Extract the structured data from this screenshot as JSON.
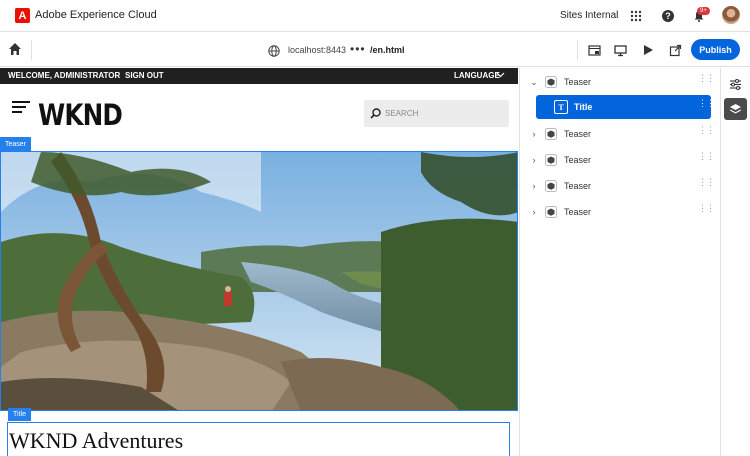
{
  "header": {
    "product_name": "Adobe Experience Cloud",
    "logo_letter": "A",
    "org_name": "Sites Internal",
    "notifications_badge": "9+"
  },
  "toolbar": {
    "host": "localhost:8443",
    "more_label": "•••",
    "path": "/en.html",
    "publish_label": "Publish"
  },
  "site": {
    "welcome_text": "WELCOME, ADMINISTRATOR",
    "sign_out": "SIGN OUT",
    "language": "LANGUAGE",
    "logo": "WKND",
    "search_placeholder": "SEARCH",
    "teaser_tag": "Teaser",
    "title_tag": "Title",
    "page_title": "WKND Adventures"
  },
  "tree": {
    "items": [
      {
        "label": "Teaser",
        "expanded": true
      },
      {
        "label": "Title",
        "selected": true
      },
      {
        "label": "Teaser",
        "expanded": false
      },
      {
        "label": "Teaser",
        "expanded": false
      },
      {
        "label": "Teaser",
        "expanded": false
      },
      {
        "label": "Teaser",
        "expanded": false
      }
    ]
  },
  "colors": {
    "accent": "#0265dc",
    "selection_outline": "#2680eb",
    "brand_red": "#eb1000"
  }
}
